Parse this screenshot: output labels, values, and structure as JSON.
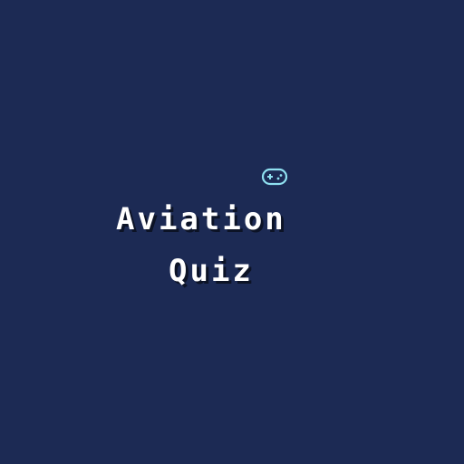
{
  "colors": {
    "background": "#1c2a54",
    "title_text": "#ffffff",
    "icon": "#8fe0f0"
  },
  "icon": {
    "name": "gamepad-icon"
  },
  "title": {
    "line1": "Aviation",
    "line2": "Quiz"
  }
}
